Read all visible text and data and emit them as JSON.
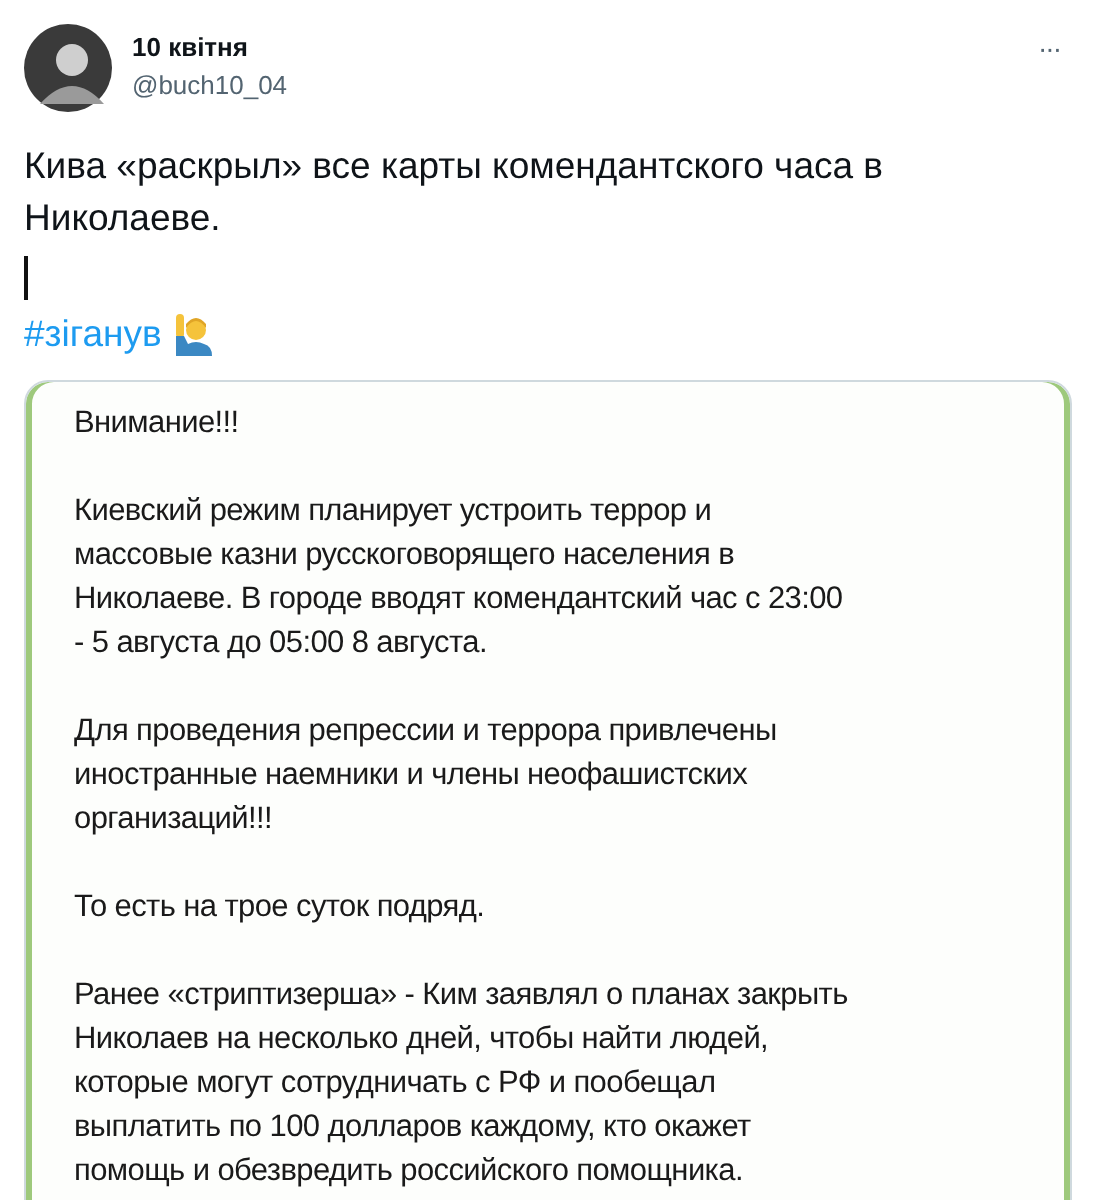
{
  "tweet": {
    "author_name": "10 квітня",
    "handle": "@buch10_04",
    "more": "···",
    "text_lines": [
      "Кива «раскрыл» все карты комендантского часа в",
      "Николаеве."
    ],
    "text_cursor": true,
    "hashtag": "#зіганув"
  },
  "embedded_message": {
    "paragraphs": [
      {
        "lines": [
          "Внимание!!!"
        ]
      },
      {
        "lines": [
          "Киевский режим планирует устроить террор и",
          "массовые казни русскоговорящего населения в",
          "Николаеве. В городе вводят комендантский час с 23:00",
          "- 5 августа до 05:00 8 августа."
        ]
      },
      {
        "lines": [
          "Для проведения репрессии и террора привлечены",
          "иностранные наемники и члены неофашистских",
          "организаций!!!"
        ]
      },
      {
        "lines": [
          "То есть на трое суток подряд."
        ]
      },
      {
        "lines": [
          "Ранее «стриптизерша» - Ким заявлял о планах закрыть",
          "Николаев на несколько дней, чтобы найти людей,",
          "которые могут сотрудничать с РФ и пообещал",
          "выплатить по 100 долларов каждому, кто окажет",
          "помощь и обезвредить российского помощника."
        ]
      }
    ]
  }
}
